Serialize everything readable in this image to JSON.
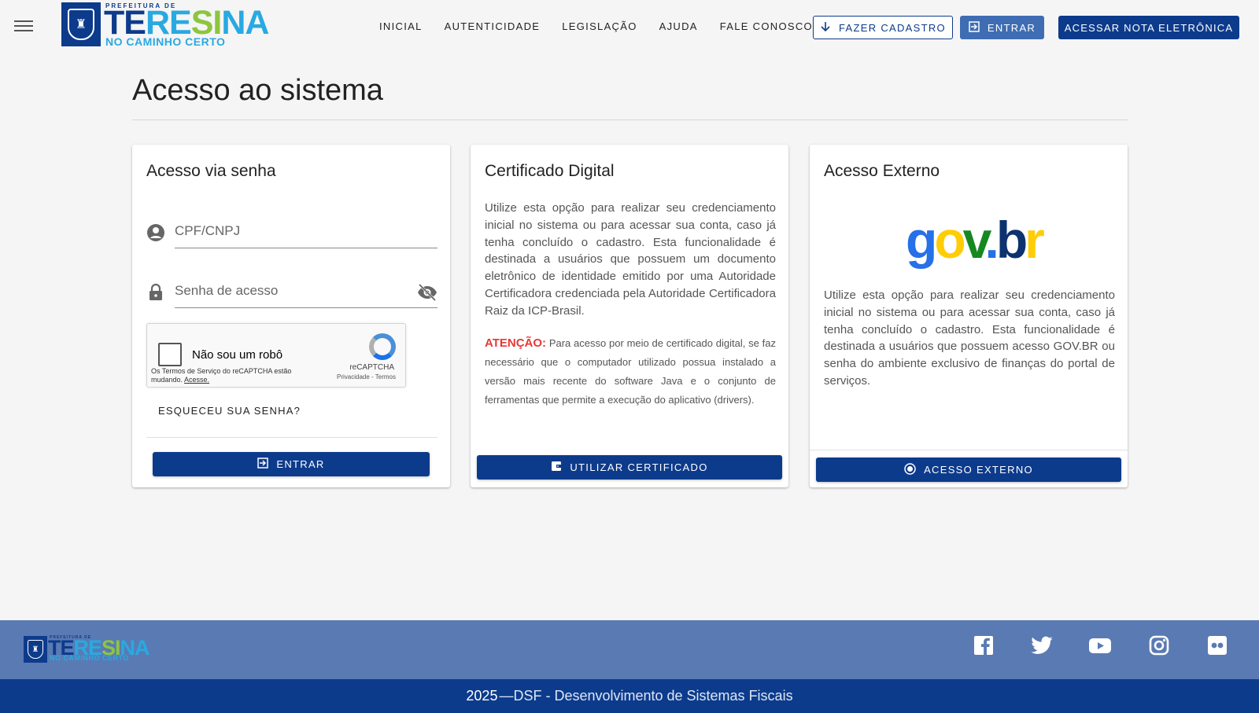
{
  "header": {
    "logo": {
      "top": "PREFEITURA DE",
      "name_parts": [
        "TE",
        "RE",
        "SI",
        "NA"
      ],
      "sub": "NO CAMINHO CERTO"
    },
    "nav": [
      "INICIAL",
      "AUTENTICIDADE",
      "LEGISLAÇÃO",
      "AJUDA",
      "FALE CONOSCO"
    ],
    "register_label": "FAZER CADASTRO",
    "login_label": "ENTRAR",
    "invoice_label": "ACESSAR NOTA ELETRÔNICA"
  },
  "page": {
    "title": "Acesso ao sistema"
  },
  "cards": {
    "password": {
      "title": "Acesso via senha",
      "cpf_placeholder": "CPF/CNPJ",
      "password_placeholder": "Senha de acesso",
      "recaptcha": {
        "label": "Não sou um robô",
        "terms": "Os Termos de Serviço do reCAPTCHA estão mudando.",
        "terms_link": "Acesse.",
        "brand": "reCAPTCHA",
        "privacy": "Privacidade - Termos"
      },
      "forgot_label": "ESQUECEU SUA SENHA?",
      "button_label": "ENTRAR"
    },
    "certificate": {
      "title": "Certificado Digital",
      "description": "Utilize esta opção para realizar seu credenciamento inicial no sistema ou para acessar sua conta, caso já tenha concluído o cadastro. Esta funcionalidade é destinada a usuários que possuem um documento eletrônico de identidade emitido por uma Autoridade Certificadora credenciada pela Autoridade Certificadora Raiz da ICP-Brasil.",
      "attention_label": "ATENÇÃO:",
      "attention_text": "Para acesso por meio de certificado digital, se faz necessário que o computador utilizado possua instalado a versão mais recente do software Java e o conjunto de ferramentas que permite a execução do aplicativo (drivers).",
      "button_label": "UTILIZAR CERTIFICADO"
    },
    "external": {
      "title": "Acesso Externo",
      "logo_parts": [
        "g",
        "o",
        "v",
        ".",
        "b",
        "r"
      ],
      "description": "Utilize esta opção para realizar seu credenciamento inicial no sistema ou para acessar sua conta, caso já tenha concluído o cadastro. Esta funcionalidade é destinada a usuários que possuem acesso GOV.BR ou senha do ambiente exclusivo de finanças do portal de serviços.",
      "button_label": "ACESSO EXTERNO"
    }
  },
  "footer": {
    "social_icons": [
      "facebook-icon",
      "twitter-icon",
      "youtube-icon",
      "instagram-icon",
      "flickr-icon"
    ],
    "year": "2025",
    "credit": "—DSF - Desenvolvimento de Sistemas Fiscais"
  },
  "colors": {
    "primary": "#0d3b8c",
    "accent": "#3f6db3",
    "footer": "#5a7ab3",
    "attention": "#e53935"
  }
}
